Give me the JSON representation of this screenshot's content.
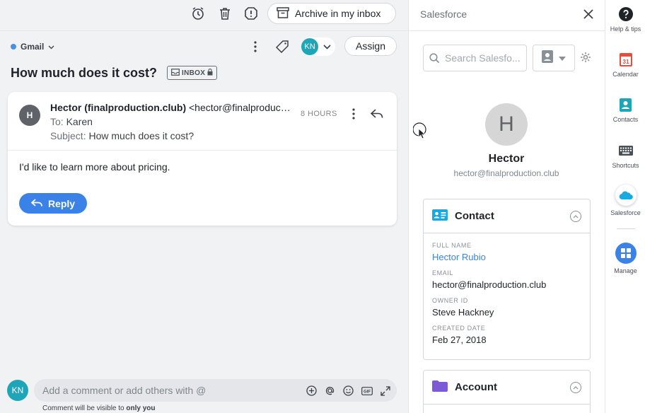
{
  "topbar": {
    "archive_label": "Archive in my inbox"
  },
  "toolbar": {
    "source_label": "Gmail",
    "assignee_initials": "KN",
    "assign_label": "Assign"
  },
  "conversation": {
    "subject": "How much does it cost?",
    "tag_label": "INBOX"
  },
  "message": {
    "sender_initial": "H",
    "sender_name": "Hector (finalproduction.club)",
    "sender_email": "<hector@finalproduction.club>",
    "to_label": "To:",
    "to_value": "Karen",
    "subject_label": "Subject:",
    "subject_value": "How much does it cost?",
    "time": "8 HOURS",
    "body": "I'd like to learn more about pricing.",
    "reply_label": "Reply"
  },
  "comment": {
    "user_initials": "KN",
    "placeholder": "Add a comment or add others with @",
    "note_prefix": "Comment will be visible to",
    "note_emphasis": "only you"
  },
  "salesforce": {
    "title": "Salesforce",
    "search_placeholder": "Search Salesfo...",
    "contact_initial": "H",
    "contact_name": "Hector",
    "contact_email": "hector@finalproduction.club",
    "contact_section": {
      "title": "Contact",
      "fields": [
        {
          "label": "FULL NAME",
          "value": "Hector Rubio"
        },
        {
          "label": "EMAIL",
          "value": "hector@finalproduction.club"
        },
        {
          "label": "OWNER ID",
          "value": "Steve Hackney"
        },
        {
          "label": "CREATED DATE",
          "value": "Feb 27, 2018"
        }
      ]
    },
    "account_section": {
      "title": "Account"
    }
  },
  "rail": {
    "items": [
      {
        "label": "Help & tips",
        "icon": "help-icon"
      },
      {
        "label": "Calendar",
        "icon": "calendar-icon",
        "badge": "31"
      },
      {
        "label": "Contacts",
        "icon": "contacts-icon"
      },
      {
        "label": "Shortcuts",
        "icon": "keyboard-icon"
      },
      {
        "label": "Salesforce",
        "icon": "salesforce-icon"
      },
      {
        "label": "Manage",
        "icon": "manage-icon"
      }
    ]
  },
  "colors": {
    "accent": "#3b82e8",
    "teal": "#1fa5b8",
    "calendar_red": "#e74c3c",
    "contact_blue": "#19a9e1",
    "account_purple": "#7b5cd6"
  }
}
